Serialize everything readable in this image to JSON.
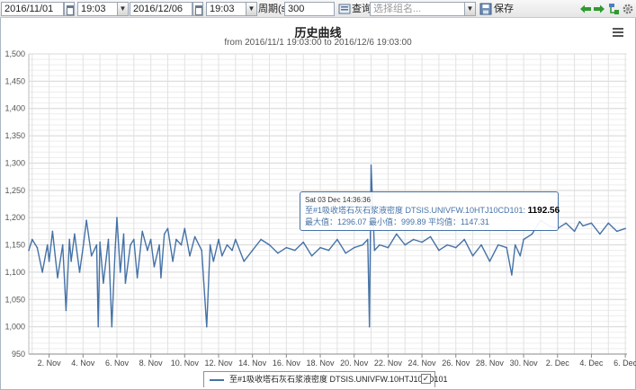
{
  "toolbar": {
    "start_date": "2016/11/01",
    "start_time": "19:03",
    "end_date": "2016/12/06",
    "end_time": "19:03",
    "period_label": "周期(s):",
    "period_value": "300",
    "query_label": "查询",
    "group_placeholder": "选择组名...",
    "save_label": "保存"
  },
  "chart": {
    "title": "历史曲线",
    "subtitle": "from 2016/11/1 19:03:00 to 2016/12/6 19:03:00"
  },
  "tooltip": {
    "time": "Sat 03 Dec 14:36:36",
    "series_label": "至#1吸收塔石灰石浆液密度  DTSIS.UNIVFW.10HTJ10CD101:",
    "value": "1192.56",
    "stats": "最大值：1296.07 最小值：999.89 平均值：1147.31"
  },
  "legend": {
    "label": "至#1吸收塔石灰石浆液密度  DTSIS.UNIVFW.10HTJ10CD101",
    "checked": "✓"
  },
  "colors": {
    "series": "#4572a7",
    "grid": "#d8d8d8",
    "toolbar_green": "#2e9b2e"
  },
  "chart_data": {
    "type": "line",
    "title": "历史曲线",
    "subtitle": "from 2016/11/1 19:03:00 to 2016/12/6 19:03:00",
    "ylim": [
      950,
      1500
    ],
    "yticks": [
      950,
      1000,
      1050,
      1100,
      1150,
      1200,
      1250,
      1300,
      1350,
      1400,
      1450,
      1500
    ],
    "ytick_labels": [
      "950",
      "1,000",
      "1,050",
      "1,100",
      "1,150",
      "1,200",
      "1,250",
      "1,300",
      "1,350",
      "1,400",
      "1,450",
      "1,500"
    ],
    "xlim": [
      0.8,
      36.1
    ],
    "xticks": [
      2,
      4,
      6,
      8,
      10,
      12,
      14,
      16,
      18,
      20,
      22,
      24,
      26,
      28,
      30,
      32,
      34,
      36
    ],
    "xtick_labels": [
      "2. Nov",
      "4. Nov",
      "6. Nov",
      "8. Nov",
      "10. Nov",
      "12. Nov",
      "14. Nov",
      "16. Nov",
      "18. Nov",
      "20. Nov",
      "22. Nov",
      "24. Nov",
      "26. Nov",
      "28. Nov",
      "30. Nov",
      "2. Dec",
      "4. Dec",
      "6. Dec"
    ],
    "grid": true,
    "legend_position": "bottom-center",
    "series": [
      {
        "name": "至#1吸收塔石灰石浆液密度  DTSIS.UNIVFW.10HTJ10CD101",
        "x": [
          0.8,
          1.0,
          1.3,
          1.6,
          1.9,
          2.0,
          2.2,
          2.5,
          2.8,
          3.0,
          3.2,
          3.3,
          3.5,
          3.8,
          4.0,
          4.2,
          4.5,
          4.8,
          4.9,
          5.0,
          5.2,
          5.5,
          5.7,
          5.9,
          6.0,
          6.2,
          6.4,
          6.5,
          6.8,
          7.0,
          7.2,
          7.5,
          7.8,
          8.0,
          8.2,
          8.5,
          8.6,
          8.8,
          9.0,
          9.3,
          9.5,
          9.8,
          10.0,
          10.3,
          10.6,
          11.0,
          11.3,
          11.5,
          11.7,
          12.0,
          12.2,
          12.5,
          12.8,
          13.0,
          13.5,
          14.0,
          14.5,
          15.0,
          15.5,
          16.0,
          16.5,
          17.0,
          17.5,
          18.0,
          18.5,
          19.0,
          19.5,
          20.0,
          20.5,
          20.8,
          20.9,
          21.0,
          21.2,
          21.5,
          22.0,
          22.5,
          23.0,
          23.5,
          24.0,
          24.5,
          25.0,
          25.5,
          26.0,
          26.5,
          27.0,
          27.5,
          28.0,
          28.5,
          29.0,
          29.3,
          29.5,
          29.8,
          30.0,
          30.5,
          31.0,
          31.5,
          32.0,
          32.5,
          33.0,
          33.3,
          33.5,
          34.0,
          34.5,
          35.0,
          35.5,
          36.0
        ],
        "y": [
          1140,
          1160,
          1145,
          1100,
          1150,
          1120,
          1175,
          1090,
          1150,
          1030,
          1160,
          1120,
          1170,
          1100,
          1145,
          1195,
          1130,
          1150,
          1000,
          1155,
          1080,
          1160,
          1000,
          1145,
          1200,
          1100,
          1170,
          1080,
          1150,
          1160,
          1090,
          1175,
          1140,
          1160,
          1110,
          1150,
          1090,
          1170,
          1180,
          1120,
          1160,
          1150,
          1180,
          1130,
          1165,
          1140,
          1000,
          1150,
          1120,
          1160,
          1130,
          1150,
          1140,
          1160,
          1120,
          1140,
          1160,
          1150,
          1135,
          1145,
          1140,
          1155,
          1130,
          1145,
          1140,
          1160,
          1135,
          1145,
          1150,
          1160,
          1000,
          1296,
          1140,
          1150,
          1145,
          1170,
          1150,
          1160,
          1155,
          1165,
          1140,
          1150,
          1145,
          1160,
          1130,
          1150,
          1120,
          1150,
          1145,
          1095,
          1150,
          1130,
          1160,
          1170,
          1195,
          1185,
          1180,
          1190,
          1175,
          1192.56,
          1185,
          1190,
          1170,
          1190,
          1175,
          1180
        ]
      }
    ]
  }
}
